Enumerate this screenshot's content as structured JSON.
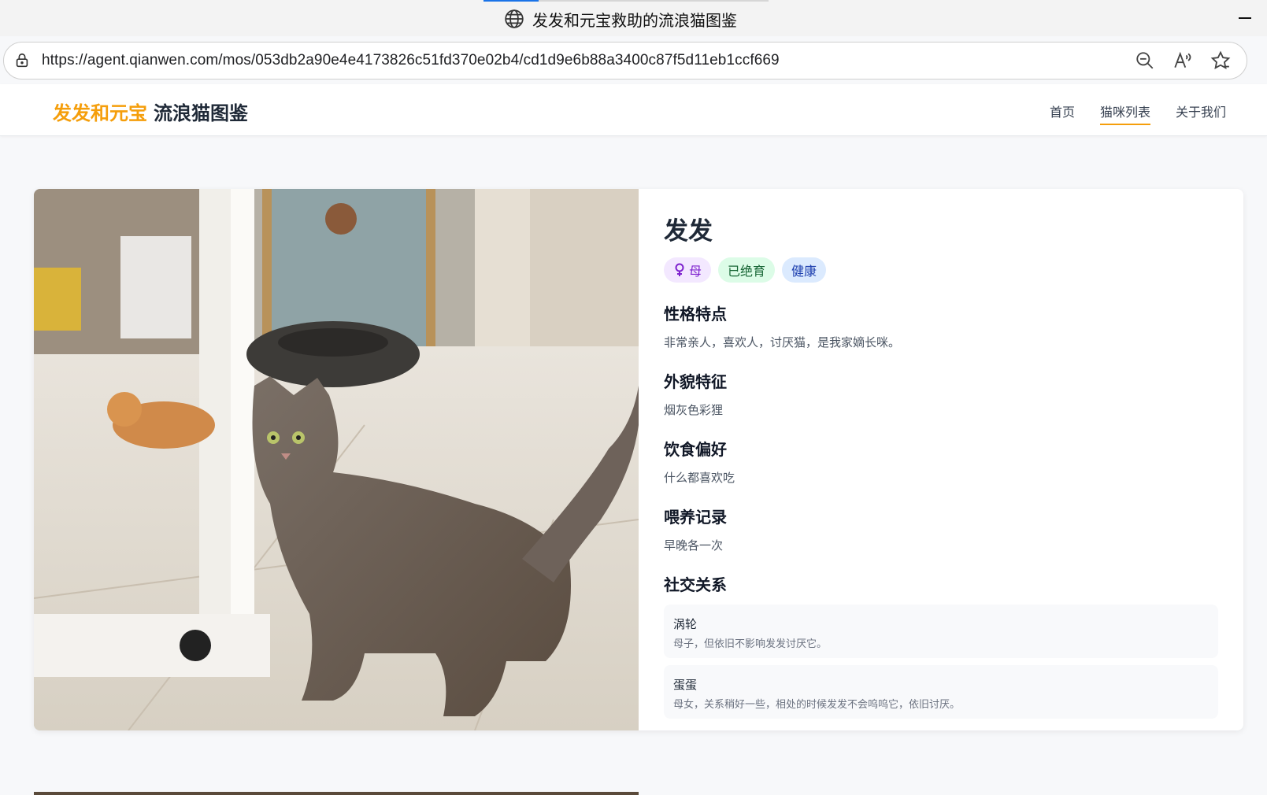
{
  "browser": {
    "tab_title": "发发和元宝救助的流浪猫图鉴",
    "url": "https://agent.qianwen.com/mos/053db2a90e4e4173826c51fd370e02b4/cd1d9e6b88a3400c87f5d11eb1ccf669",
    "icons": [
      "globe-icon",
      "lock-icon",
      "zoom-out-icon",
      "read-aloud-icon",
      "favorite-star-icon",
      "minimize-icon"
    ]
  },
  "site": {
    "brand_accent": "发发和元宝",
    "brand_main": "流浪猫图鉴",
    "nav": [
      {
        "label": "首页",
        "active": false
      },
      {
        "label": "猫咪列表",
        "active": true
      },
      {
        "label": "关于我们",
        "active": false
      }
    ],
    "colors": {
      "accent": "#f59e0b",
      "background": "#f7f8fa"
    }
  },
  "cat": {
    "name": "发发",
    "tags": {
      "gender": "母",
      "neutered": "已绝育",
      "health": "健康"
    },
    "sections": [
      {
        "title": "性格特点",
        "text": "非常亲人，喜欢人，讨厌猫，是我家嫡长咪。"
      },
      {
        "title": "外貌特征",
        "text": "烟灰色彩狸"
      },
      {
        "title": "饮食偏好",
        "text": "什么都喜欢吃"
      },
      {
        "title": "喂养记录",
        "text": "早晚各一次"
      }
    ],
    "social_title": "社交关系",
    "relations": [
      {
        "name": "涡轮",
        "desc": "母子，但依旧不影响发发讨厌它。"
      },
      {
        "name": "蛋蛋",
        "desc": "母女，关系稍好一些，相处的时候发发不会呜呜它，依旧讨厌。"
      }
    ]
  }
}
